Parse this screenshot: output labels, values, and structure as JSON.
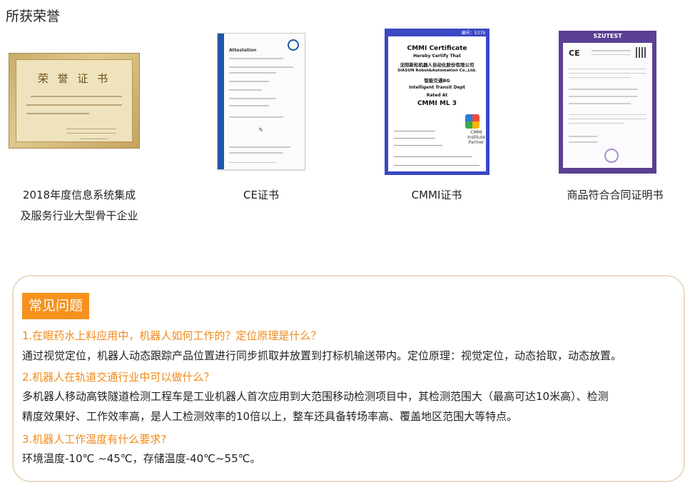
{
  "section": {
    "title": "所获荣誉"
  },
  "certificates": [
    {
      "caption_lines": [
        "2018年度信息系统集成",
        "及服务行业大型骨干企业"
      ],
      "image_heading": "荣 誉 证 书"
    },
    {
      "caption_lines": [
        "CE证书"
      ],
      "image_heading": "Attestation"
    },
    {
      "caption_lines": [
        "CMMI证书"
      ],
      "image_number": "编号：5379",
      "image_lines": [
        "CMMI Certificate",
        "Hereby Certify That",
        "沈阳新松机器人自动化股份有限公司",
        "SIASUN Robot&Automation Co.,Ltd.",
        "智能交通BG",
        "Intelligent Transit Dept",
        "Rated At",
        "CMMI ML 3"
      ],
      "mark_text": [
        "CMMI",
        "Institute",
        "Partner"
      ]
    },
    {
      "caption_lines": [
        "商品符合合同证明书"
      ],
      "brand": "SZUTEST",
      "image_heading": "CE"
    }
  ],
  "faq": {
    "title": "常见问题",
    "items": [
      {
        "question": "1.在眼药水上料应用中，机器人如何工作的？定位原理是什么？",
        "answer": "通过视觉定位，机器人动态跟踪产品位置进行同步抓取并放置到打标机输送带内。定位原理：视觉定位，动态拾取，动态放置。"
      },
      {
        "question": "2.机器人在轨道交通行业中可以做什么？",
        "answer_lines": [
          "多机器人移动高铁隧道检测工程车是工业机器人首次应用到大范围移动检测项目中，其检测范围大（最高可达10米高）、检测",
          "精度效果好、工作效率高，是人工检测效率的10倍以上，整车还具备转场率高、覆盖地区范围大等特点。"
        ]
      },
      {
        "question": "3.机器人工作温度有什么要求?",
        "answer": "环境温度-10℃ ~45℃，存储温度-40℃~55℃。"
      }
    ]
  }
}
